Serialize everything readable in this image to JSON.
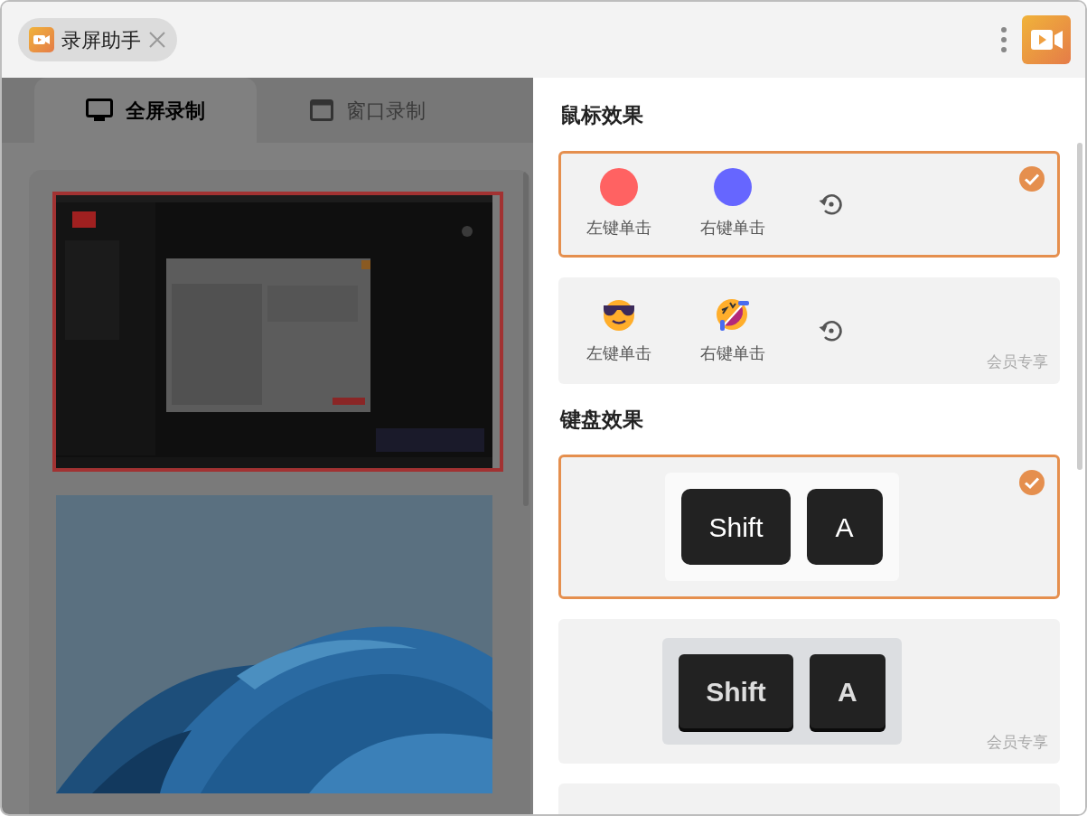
{
  "window": {
    "tab": {
      "title": "录屏助手"
    }
  },
  "capture_tabs": [
    {
      "label": "全屏录制",
      "selected": true,
      "kind": "monitor"
    },
    {
      "label": "窗口录制",
      "selected": false,
      "kind": "window"
    }
  ],
  "screens": [
    {
      "kind": "desktop",
      "selected": true
    },
    {
      "kind": "wallpaper",
      "selected": false
    }
  ],
  "mouse_effects": {
    "title": "鼠标效果",
    "options": [
      {
        "kind": "dots",
        "selected": true,
        "left_label": "左键单击",
        "right_label": "右键单击"
      },
      {
        "kind": "emoji",
        "selected": false,
        "left_label": "左键单击",
        "right_label": "右键单击",
        "badge": "会员专享"
      }
    ]
  },
  "keyboard_effects": {
    "title": "键盘效果",
    "options": [
      {
        "kind": "flat",
        "selected": true,
        "keys": [
          "Shift",
          "A"
        ]
      },
      {
        "kind": "raised",
        "selected": false,
        "keys": [
          "Shift",
          "A"
        ],
        "badge": "会员专享"
      }
    ]
  }
}
